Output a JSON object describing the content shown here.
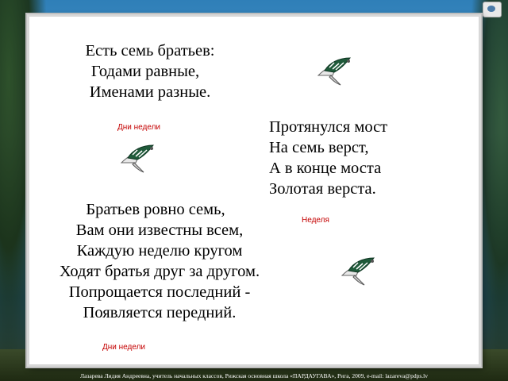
{
  "riddle1": {
    "lines": [
      "Есть семь братьев:",
      "Годами равные,",
      "Именами разные."
    ],
    "answer": "Дни недели"
  },
  "riddle2": {
    "lines": [
      "Протянулся мост",
      "На семь верст,",
      "А в конце моста",
      "Золотая верста."
    ],
    "answer": "Неделя"
  },
  "riddle3": {
    "lines": [
      "Братьев ровно семь,",
      "Вам они известны всем,",
      "Каждую неделю кругом",
      "Ходят братья друг за другом.",
      "Попрощается последний -",
      "Появляется передний."
    ],
    "answer": "Дни недели"
  },
  "icons": {
    "bird": "dove-icon",
    "corner": "slide-corner-icon"
  },
  "colors": {
    "answer": "#c40000",
    "text": "#000000"
  },
  "footer": "Лазарева Лидия Андреевна,  учитель начальных классов,  Рижская основная школа «ПАРДАУГАВА»,  Рига,  2009,  e-mail: lazareva@pdps.lv"
}
